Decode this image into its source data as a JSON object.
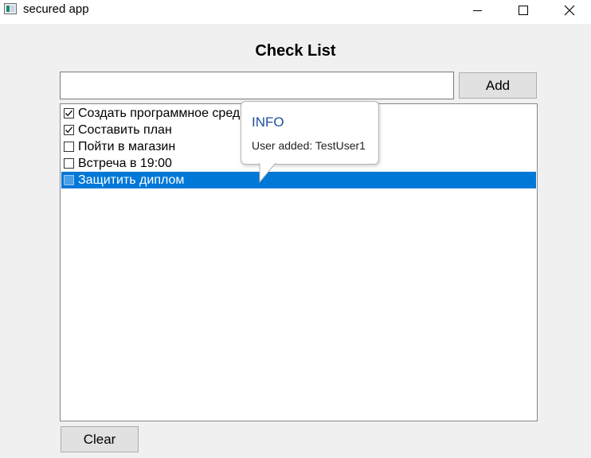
{
  "window": {
    "title": "secured app"
  },
  "header": {
    "title": "Check List"
  },
  "entry": {
    "value": "",
    "add_label": "Add"
  },
  "checklist": {
    "items": [
      {
        "label": "Создать программное средство",
        "checked": true,
        "selected": false
      },
      {
        "label": "Составить план",
        "checked": true,
        "selected": false
      },
      {
        "label": "Пойти в магазин",
        "checked": false,
        "selected": false
      },
      {
        "label": "Встреча в 19:00",
        "checked": false,
        "selected": false
      },
      {
        "label": "Защитить диплом",
        "checked": false,
        "selected": true
      }
    ]
  },
  "footer": {
    "clear_label": "Clear"
  },
  "tooltip": {
    "title": "INFO",
    "message": "User added: TestUser1"
  },
  "colors": {
    "selection": "#0078d7",
    "tooltip_title": "#1f4e9e"
  }
}
